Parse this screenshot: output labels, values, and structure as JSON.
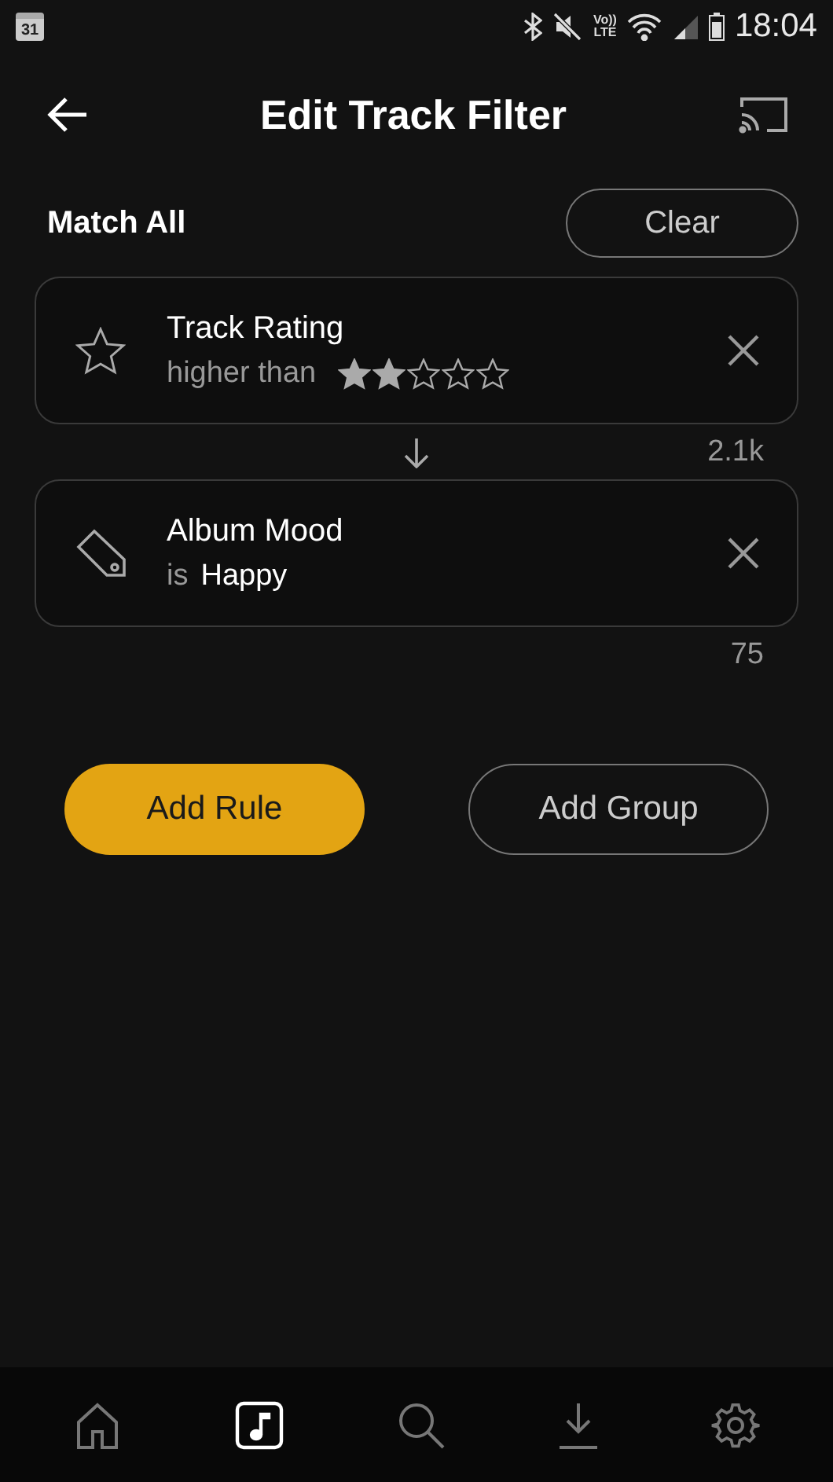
{
  "status_bar": {
    "calendar_day": "31",
    "volte": [
      "Vo))",
      "LTE"
    ],
    "time": "18:04"
  },
  "header": {
    "title": "Edit Track Filter"
  },
  "match": {
    "label": "Match All",
    "clear_button": "Clear"
  },
  "rules": [
    {
      "kind": "rating",
      "field": "Track Rating",
      "operator": "higher than",
      "stars": 2,
      "count": "2.1k"
    },
    {
      "kind": "value",
      "field": "Album Mood",
      "operator": "is",
      "value": "Happy",
      "count": "75"
    }
  ],
  "buttons": {
    "add_rule": "Add Rule",
    "add_group": "Add Group"
  },
  "nav": [
    {
      "selected": false
    },
    {
      "selected": true
    },
    {
      "selected": false
    },
    {
      "selected": false
    },
    {
      "selected": false
    }
  ]
}
